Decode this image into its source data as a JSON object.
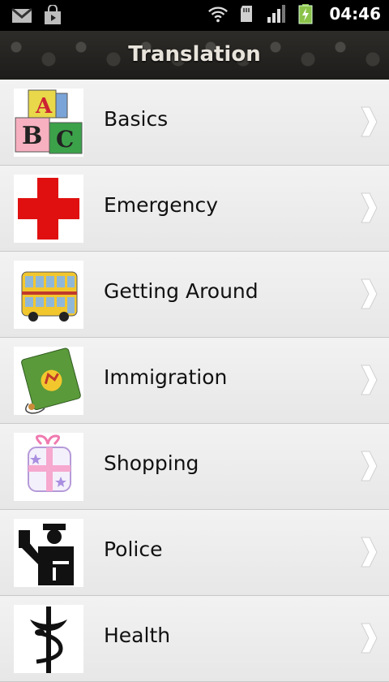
{
  "status_bar": {
    "time": "04:46",
    "icons": [
      "gmail-icon",
      "store-bag-icon",
      "wifi-icon",
      "sd-card-icon",
      "signal-icon",
      "battery-charging-icon"
    ]
  },
  "header": {
    "title": "Translation"
  },
  "list": {
    "items": [
      {
        "label": "Basics",
        "icon": "abc-blocks-icon"
      },
      {
        "label": "Emergency",
        "icon": "red-cross-icon"
      },
      {
        "label": "Getting Around",
        "icon": "bus-icon"
      },
      {
        "label": "Immigration",
        "icon": "passport-icon"
      },
      {
        "label": "Shopping",
        "icon": "gift-box-icon"
      },
      {
        "label": "Police",
        "icon": "police-officer-icon"
      },
      {
        "label": "Health",
        "icon": "caduceus-icon"
      }
    ]
  },
  "colors": {
    "title_bar": "#2b2926",
    "row_bg": "#ececec",
    "chevron": "#ffffff",
    "red_cross": "#e01010"
  }
}
